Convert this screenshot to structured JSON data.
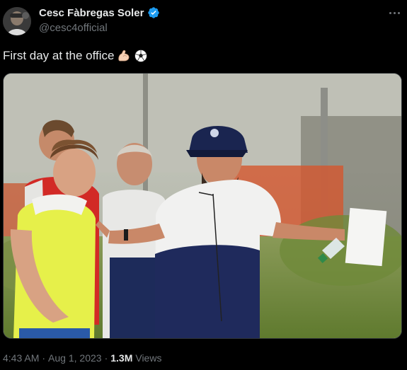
{
  "tweet": {
    "display_name": "Cesc Fàbregas Soler",
    "handle": "@cesc4official",
    "text": "First day at the office",
    "emojis": [
      "flexed-biceps-icon",
      "soccer-ball-icon"
    ],
    "time": "4:43 AM",
    "separator": "·",
    "date": "Aug 1, 2023",
    "views_count": "1.3M",
    "views_label": "Views"
  },
  "colors": {
    "background": "#000000",
    "primary_text": "#e7e9ea",
    "secondary_text": "#71767b",
    "verified": "#1d9bf0",
    "border": "#2f3336"
  }
}
